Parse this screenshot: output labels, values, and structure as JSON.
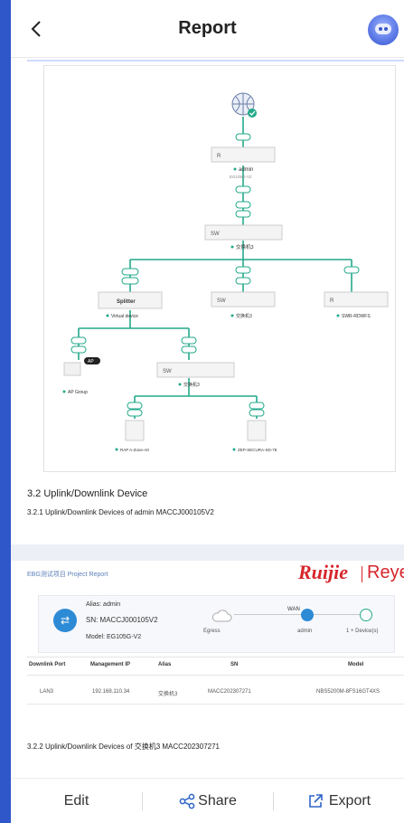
{
  "header": {
    "title": "Report"
  },
  "diagram": {
    "labels": {
      "root": "admin",
      "root_sn": "EG105G-V2",
      "sw1": "SW",
      "sw1_name": "交换机3",
      "splitter": "Splitter",
      "virtual_device": "Virtual device",
      "sw2": "SW",
      "sw2_name": "交换机3",
      "mid_right": "R",
      "mid_right_name": "SWR-RDWFS",
      "ap_tag": "AP",
      "ap_name": "AP Group",
      "sw3": "SW",
      "sw3_name": "交换机3",
      "leaf1": "RAP A-Zone-A0",
      "leaf2": "ZEP-SECURA-SD-78"
    }
  },
  "section": {
    "h32": "3.2 Uplink/Downlink Device",
    "h321": "3.2.1 Uplink/Downlink Devices of admin MACCJ000105V2",
    "h322": "3.2.2 Uplink/Downlink Devices of 交换机3 MACC202307271"
  },
  "page2": {
    "project": "EBG测试项目 Project Report",
    "brand_primary": "Ruijie",
    "brand_secondary": "Reyee",
    "device": {
      "alias": "Alias: admin",
      "sn": "SN: MACCJ000105V2",
      "model": "Model: EG105G-V2",
      "wan": "WAN",
      "egress": "Egress",
      "admin": "admin",
      "devices": "1 + Device(s)"
    },
    "table": {
      "headers": [
        "Downlink Port",
        "Management IP",
        "Alias",
        "SN",
        "Model"
      ],
      "row": [
        "LAN3",
        "192.168.110.34",
        "交换机3",
        "MACC202307271",
        "NBS5200M-8FS16GT4XS"
      ]
    }
  },
  "bottom": {
    "edit": "Edit",
    "share": "Share",
    "export": "Export"
  },
  "colors": {
    "accent": "#2e64c8",
    "brand": "#d6262c",
    "topology_line": "#23a98a"
  }
}
